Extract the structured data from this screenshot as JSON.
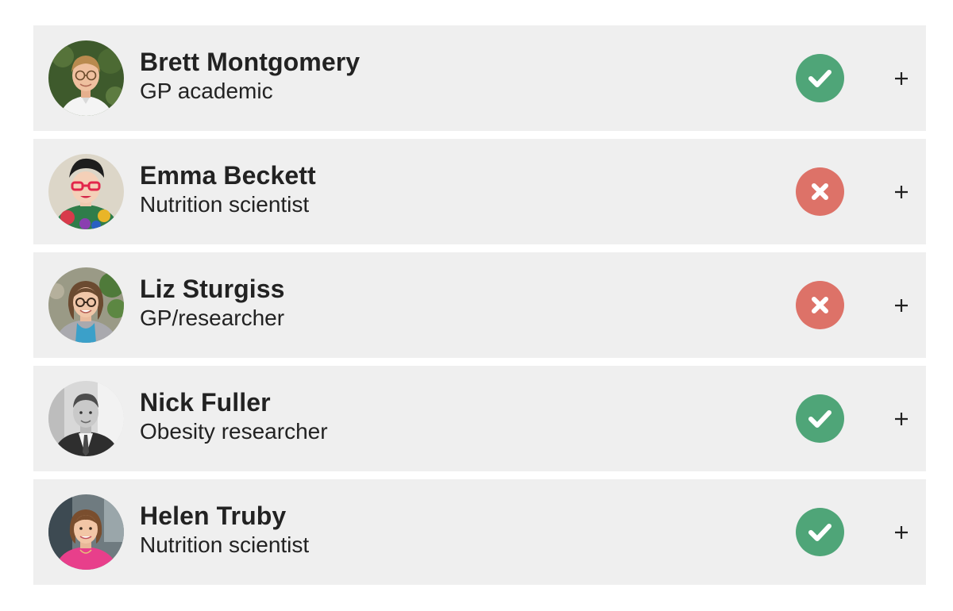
{
  "colors": {
    "row_background": "#efefef",
    "check_green": "#4fa578",
    "cross_red": "#dd7268",
    "text": "#222222"
  },
  "experts": [
    {
      "name": "Brett Montgomery",
      "role": "GP academic",
      "verdict": "check",
      "verdict_icon": "check-icon",
      "expand_icon": "plus-icon",
      "avatar": "photo-man-glasses-hedge-background"
    },
    {
      "name": "Emma Beckett",
      "role": "Nutrition scientist",
      "verdict": "cross",
      "verdict_icon": "cross-icon",
      "expand_icon": "plus-icon",
      "avatar": "photo-woman-red-glasses-colorful-top"
    },
    {
      "name": "Liz Sturgiss",
      "role": "GP/researcher",
      "verdict": "cross",
      "verdict_icon": "cross-icon",
      "expand_icon": "plus-icon",
      "avatar": "photo-woman-glasses-plants-background"
    },
    {
      "name": "Nick Fuller",
      "role": "Obesity researcher",
      "verdict": "check",
      "verdict_icon": "check-icon",
      "expand_icon": "plus-icon",
      "avatar": "photo-man-suit-black-and-white"
    },
    {
      "name": "Helen Truby",
      "role": "Nutrition scientist",
      "verdict": "check",
      "verdict_icon": "check-icon",
      "expand_icon": "plus-icon",
      "avatar": "photo-woman-pink-top-necklace"
    }
  ]
}
